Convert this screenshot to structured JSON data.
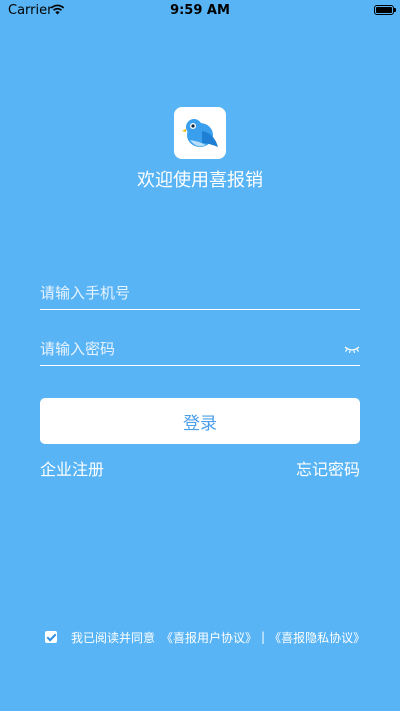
{
  "status_bar": {
    "carrier": "Carrier",
    "time": "9:59 AM",
    "battery_level": 0.95
  },
  "app": {
    "welcome": "欢迎使用喜报销"
  },
  "form": {
    "phone_placeholder": "请输入手机号",
    "password_placeholder": "请输入密码",
    "login_label": "登录",
    "register_label": "企业注册",
    "forgot_label": "忘记密码"
  },
  "agreement": {
    "checked": true,
    "prefix": "我已阅读并同意",
    "user_agreement": "《喜报用户协议》",
    "separator": "|",
    "privacy_agreement": "《喜报隐私协议》"
  },
  "colors": {
    "background": "#58b4f5",
    "button_text": "#4a9eea"
  },
  "icons": {
    "logo": "bird-logo-icon",
    "wifi": "wifi-icon",
    "battery": "battery-icon",
    "eye": "eye-closed-icon",
    "checkbox": "checkbox-checked-icon"
  }
}
